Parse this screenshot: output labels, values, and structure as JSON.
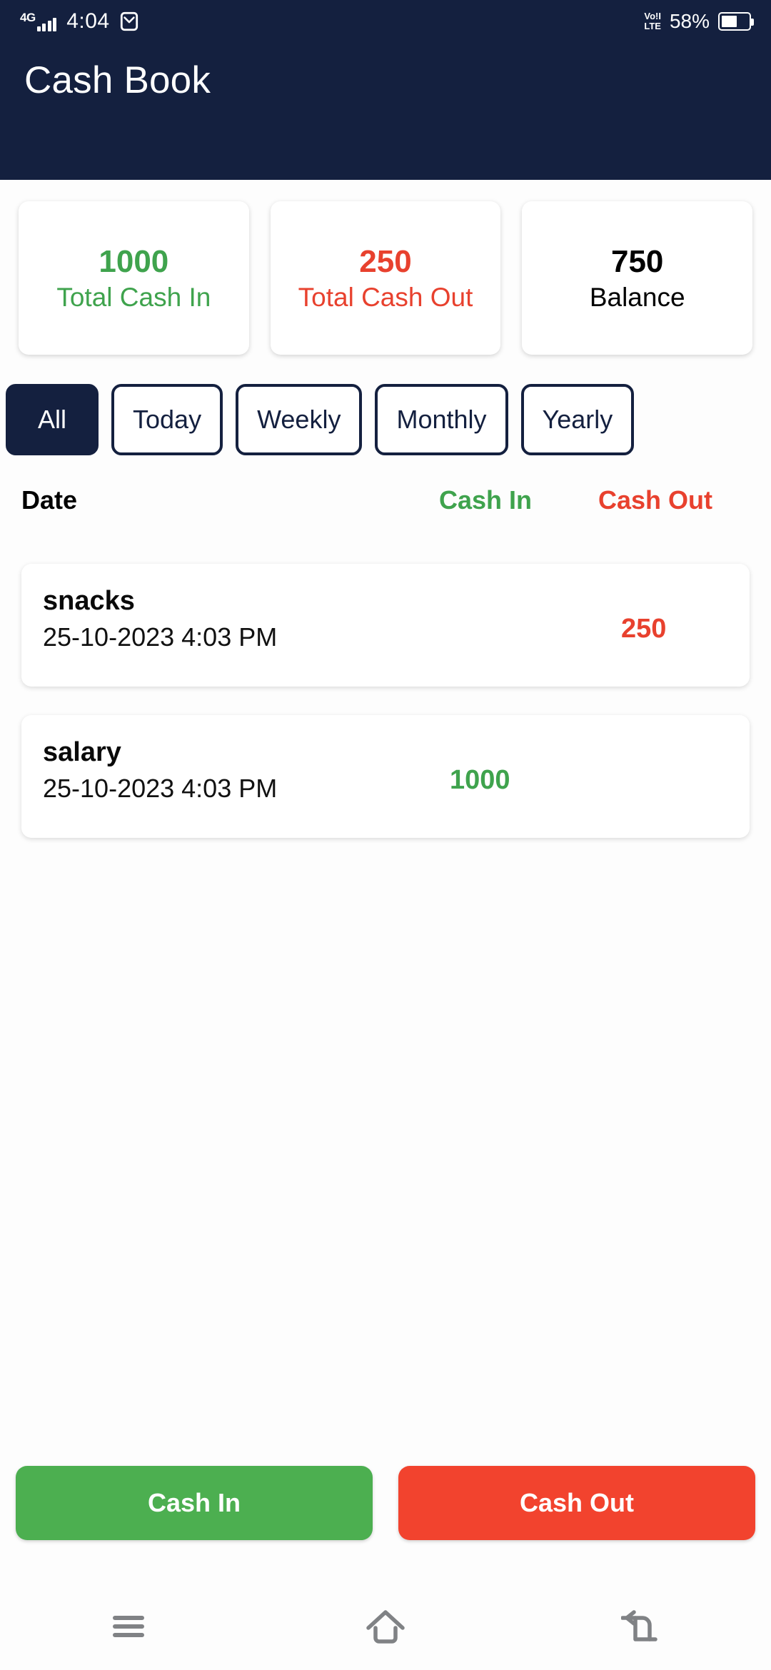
{
  "status_bar": {
    "network_type": "4G",
    "time": "4:04",
    "mail_icon": "envelope-icon",
    "volte": "VoLTE",
    "volte_line1": "VoǃI",
    "volte_line2": "LTE",
    "battery_percent": "58%",
    "battery_icon": "battery-icon"
  },
  "app_bar": {
    "title": "Cash Book"
  },
  "summary": {
    "cards": [
      {
        "value": "1000",
        "label": "Total Cash In",
        "color": "#3fa34d"
      },
      {
        "value": "250",
        "label": "Total Cash Out",
        "color": "#e8412e"
      },
      {
        "value": "750",
        "label": "Balance",
        "color": "#000000"
      }
    ]
  },
  "filters": {
    "selected": "All",
    "items": [
      {
        "label": "All",
        "active": true
      },
      {
        "label": "Today",
        "active": false
      },
      {
        "label": "Weekly",
        "active": false
      },
      {
        "label": "Monthly",
        "active": false
      },
      {
        "label": "Yearly",
        "active": false
      }
    ]
  },
  "table": {
    "headers": {
      "date": "Date",
      "cash_in": "Cash In",
      "cash_out": "Cash Out"
    },
    "rows": [
      {
        "title": "snacks",
        "datetime": "25-10-2023  4:03 PM",
        "cash_in": "",
        "cash_out": "250"
      },
      {
        "title": "salary",
        "datetime": "25-10-2023  4:03 PM",
        "cash_in": "1000",
        "cash_out": ""
      }
    ]
  },
  "actions": {
    "cash_in_label": "Cash In",
    "cash_out_label": "Cash Out"
  },
  "nav_bar": {
    "recents": "menu-icon",
    "home": "home-icon",
    "back": "back-icon"
  },
  "colors": {
    "primary": "#14203f",
    "green": "#3fa34d",
    "red": "#e8412e",
    "button_green": "#4caf50",
    "button_red": "#f2432e"
  }
}
